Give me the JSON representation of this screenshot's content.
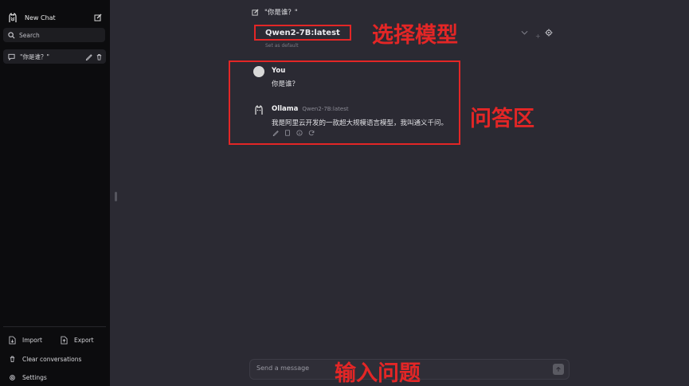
{
  "sidebar": {
    "new_chat": "New Chat",
    "search_placeholder": "Search",
    "conversations": [
      {
        "title": "\"你是谁？\""
      }
    ],
    "bottom": {
      "import": "Import",
      "export": "Export",
      "clear": "Clear conversations",
      "settings": "Settings"
    }
  },
  "header": {
    "chat_title": "\"你是谁？\"",
    "model": "Qwen2-7B:latest",
    "set_default": "Set as default"
  },
  "messages": [
    {
      "role": "user",
      "name": "You",
      "text": "你是谁？"
    },
    {
      "role": "assistant",
      "name": "Ollama",
      "model_tag": "Qwen2-7B:latest",
      "text": "我是阿里云开发的一款超大规模语言模型，我叫通义千问。"
    }
  ],
  "input": {
    "placeholder": "Send a message"
  },
  "annotations": {
    "model_select": "选择模型",
    "qa_area": "问答区",
    "input_question": "输入问题"
  },
  "colors": {
    "annotation": "#e32626",
    "sidebar_bg": "#0c0c0e",
    "main_bg": "#2b2a33"
  },
  "icons": [
    "ollama-logo",
    "edit-icon",
    "search-icon",
    "chat-bubble-icon",
    "pencil-icon",
    "trash-icon",
    "chevron-down-icon",
    "plus-icon",
    "settings-icon",
    "copy-icon",
    "info-icon",
    "refresh-icon",
    "import-icon",
    "export-icon",
    "arrow-up-icon"
  ]
}
